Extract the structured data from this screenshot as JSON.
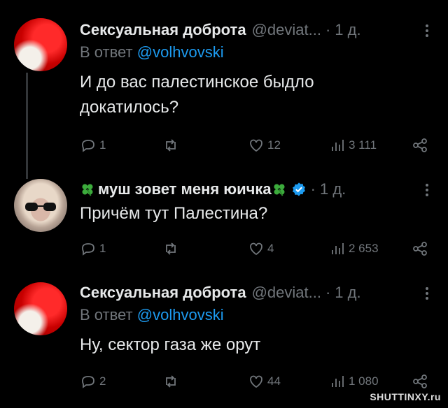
{
  "tweets": [
    {
      "name": "Сексуальная доброта",
      "handle": "@deviat...",
      "dot": "·",
      "time": "1 д.",
      "reply_prefix": "В ответ",
      "reply_to": "@volhvovski",
      "text_lines": [
        "И до вас палестинское быдло",
        "докатилось?"
      ],
      "replies": "1",
      "retweets": "",
      "likes": "12",
      "views": "3 111"
    },
    {
      "name": "муш зовет меня юичка",
      "handle": "",
      "dot": "·",
      "time": "1 д.",
      "text_lines": [
        "Причём тут Палестина?"
      ],
      "replies": "1",
      "retweets": "",
      "likes": "4",
      "views": "2 653"
    },
    {
      "name": "Сексуальная доброта",
      "handle": "@deviat...",
      "dot": "·",
      "time": "1 д.",
      "reply_prefix": "В ответ",
      "reply_to": "@volhvovski",
      "text_lines": [
        "Ну, сектор газа же орут"
      ],
      "replies": "2",
      "retweets": "",
      "likes": "44",
      "views": "1 080"
    }
  ],
  "icons": {
    "reply": "reply-icon",
    "retweet": "retweet-icon",
    "like": "heart-icon",
    "views": "views-icon",
    "share": "share-icon",
    "more": "more-icon",
    "clover": "clover-emoji",
    "verified": "verified-badge-icon"
  },
  "colors": {
    "background": "#000000",
    "text": "#e7e9ea",
    "muted": "#71767b",
    "link": "#1d9bf0",
    "verified": "#1d9bf0"
  },
  "watermark": "SHUTTINXY.ru"
}
